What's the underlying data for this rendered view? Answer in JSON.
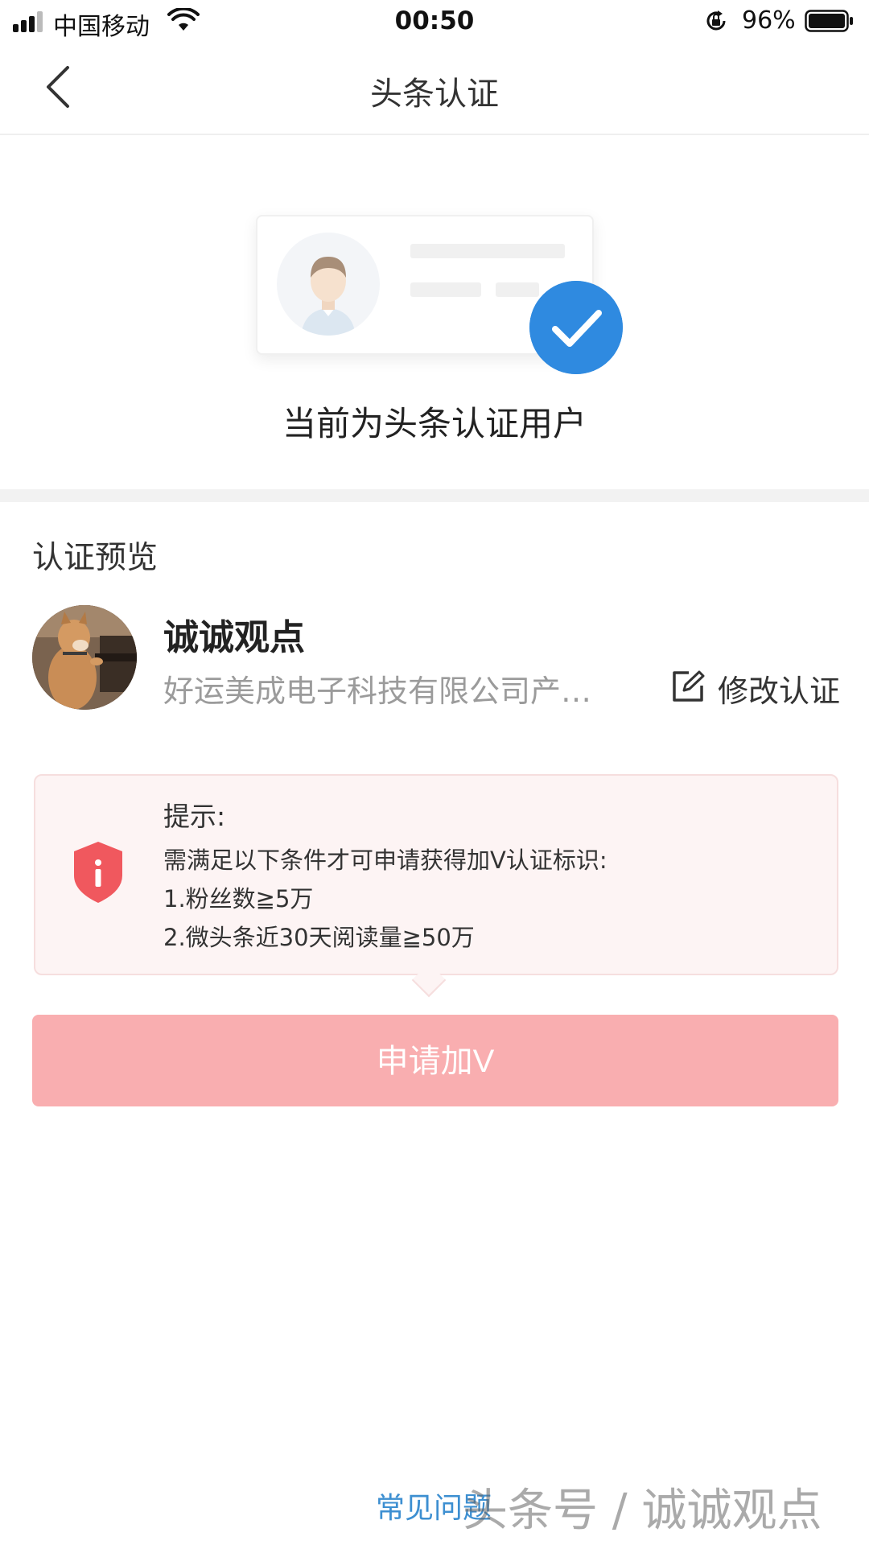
{
  "status_bar": {
    "carrier": "中国移动",
    "time": "00:50",
    "battery": "96%"
  },
  "nav": {
    "title": "头条认证"
  },
  "hero": {
    "status_text": "当前为头条认证用户"
  },
  "preview": {
    "section_title": "认证预览",
    "name": "诚诚观点",
    "description": "好运美成电子科技有限公司产…",
    "edit_label": "修改认证"
  },
  "tip": {
    "title": "提示:",
    "lines": [
      "需满足以下条件才可申请获得加V认证标识:",
      "1.粉丝数≧5万",
      "2.微头条近30天阅读量≧50万"
    ]
  },
  "apply_button": {
    "label": "申请加V"
  },
  "footer": {
    "faq": "常见问题",
    "watermark": "头条号 / 诚诚观点"
  },
  "colors": {
    "accent_blue": "#2f8ae0",
    "button_pink": "#f9aeb0",
    "tip_bg": "#fdf4f4",
    "shield_red": "#f0585e",
    "link_blue": "#3d8fd1"
  },
  "icons": {
    "back": "chevron-left-icon",
    "check": "checkmark-icon",
    "edit": "edit-icon",
    "shield": "shield-info-icon"
  }
}
